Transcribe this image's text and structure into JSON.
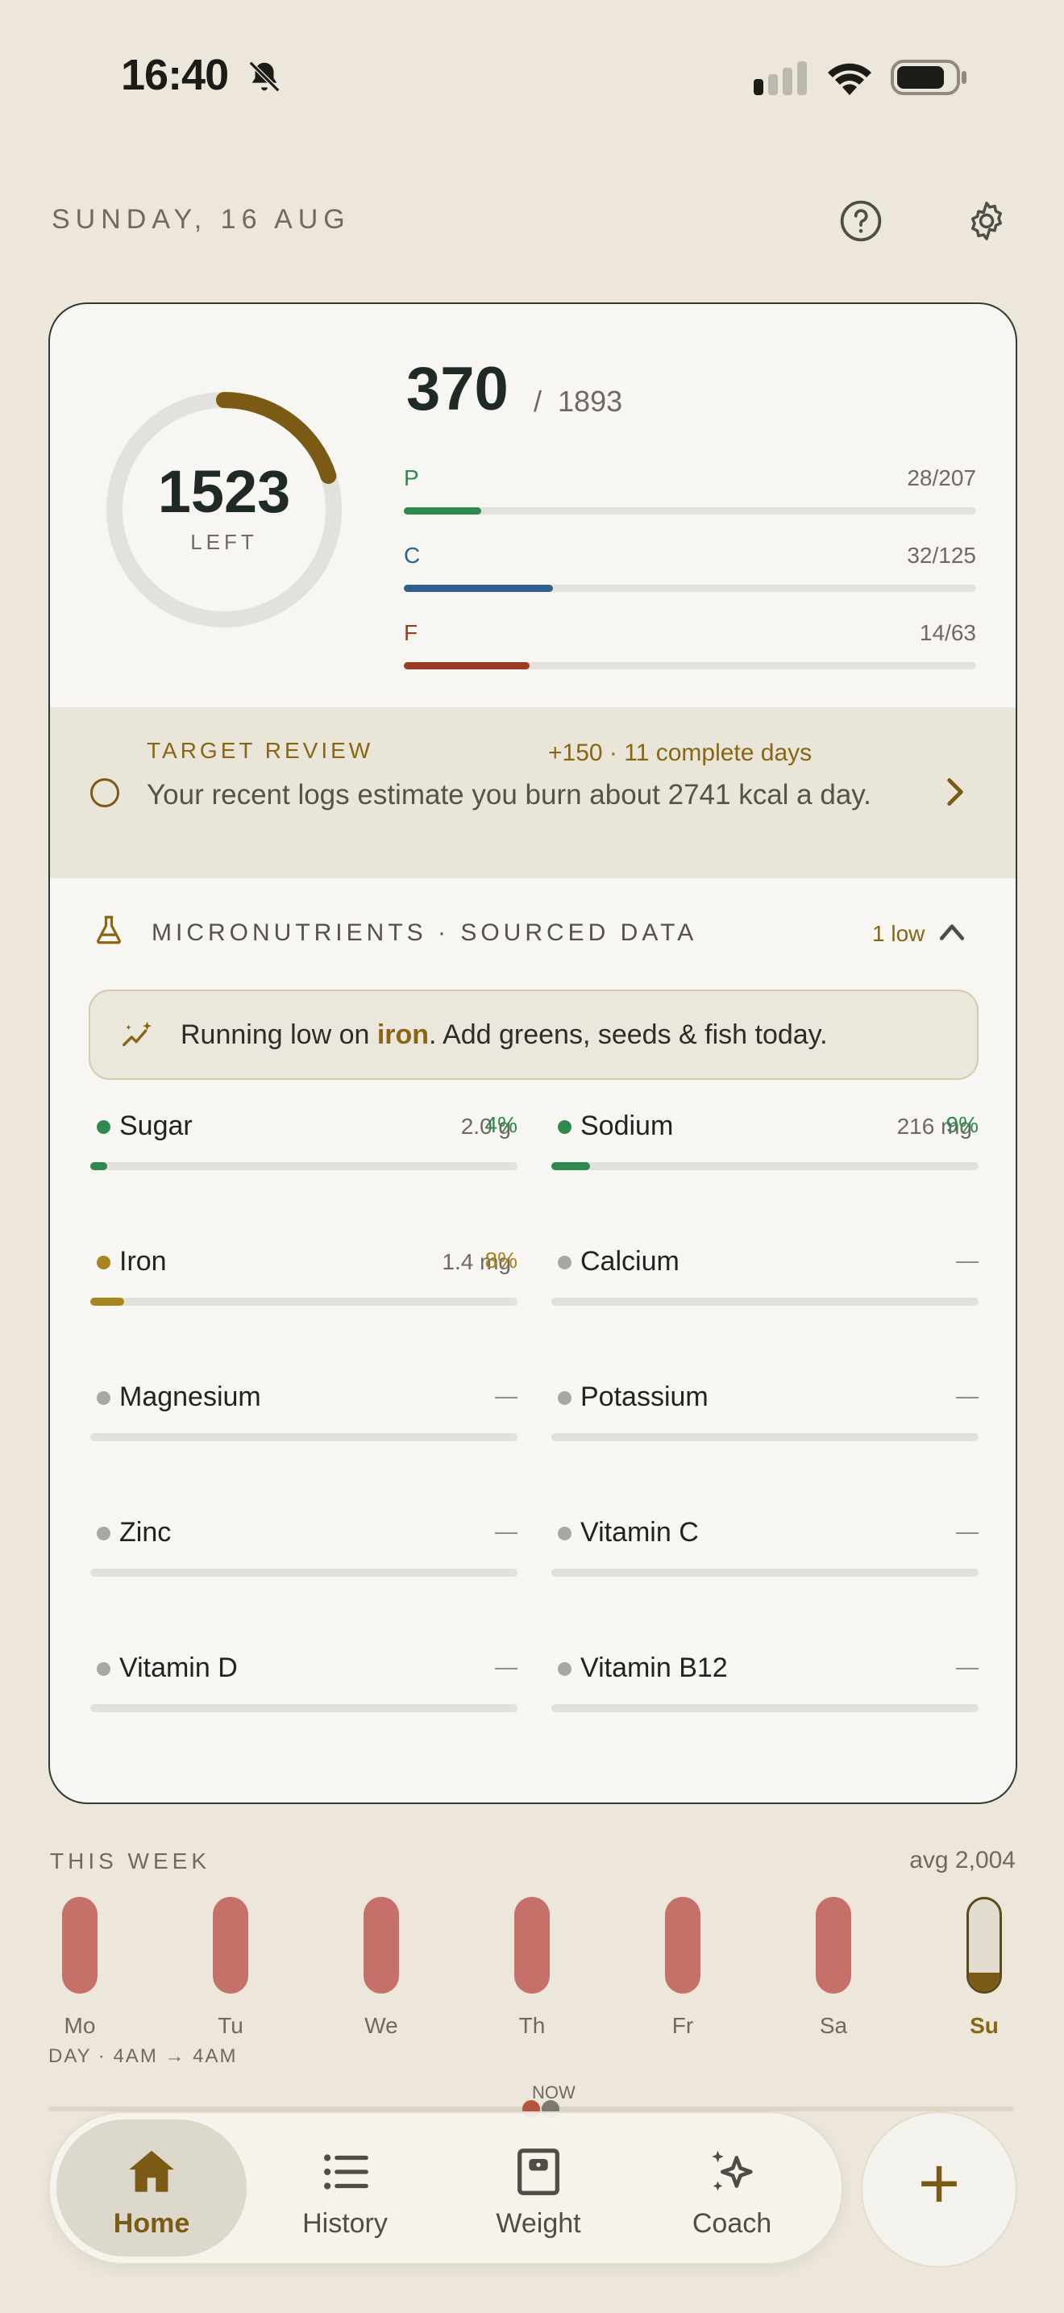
{
  "status": {
    "time": "16:40"
  },
  "header": {
    "date": "SUNDAY, 16 AUG"
  },
  "summary": {
    "left_value": "1523",
    "left_label": "LEFT",
    "eaten": "370",
    "separator": "/",
    "target": "1893",
    "ring_progress": 0.2,
    "macros": [
      {
        "letter": "P",
        "value": "28/207",
        "fraction": 0.135,
        "color": "#2e8a4c"
      },
      {
        "letter": "C",
        "value": "32/125",
        "fraction": 0.26,
        "color": "#2f5f8c"
      },
      {
        "letter": "F",
        "value": "14/63",
        "fraction": 0.22,
        "color": "#9b3b22"
      }
    ]
  },
  "review": {
    "title": "TARGET REVIEW",
    "badge": "+150 · 11 complete days",
    "text": "Your recent logs estimate you burn about 2741 kcal a day."
  },
  "micro": {
    "title": "MICRONUTRIENTS · SOURCED DATA",
    "low_count": "1 low",
    "hint_prefix": "Running low on ",
    "hint_bold": "iron",
    "hint_suffix": ". Add greens, seeds & fish today.",
    "dash": "—",
    "items": [
      {
        "name": "Sugar",
        "amount": "2.0 g",
        "pct": "4%",
        "fraction": 0.04,
        "color": "#2e8a4c"
      },
      {
        "name": "Sodium",
        "amount": "216 mg",
        "pct": "9%",
        "fraction": 0.09,
        "color": "#2e8a4c"
      },
      {
        "name": "Iron",
        "amount": "1.4 mg",
        "pct": "8%",
        "fraction": 0.08,
        "color": "#a8841e"
      },
      {
        "name": "Calcium",
        "amount": "",
        "pct": "",
        "fraction": 0,
        "color": "#a9a7a2"
      },
      {
        "name": "Magnesium",
        "amount": "",
        "pct": "",
        "fraction": 0,
        "color": "#a9a7a2"
      },
      {
        "name": "Potassium",
        "amount": "",
        "pct": "",
        "fraction": 0,
        "color": "#a9a7a2"
      },
      {
        "name": "Zinc",
        "amount": "",
        "pct": "",
        "fraction": 0,
        "color": "#a9a7a2"
      },
      {
        "name": "Vitamin C",
        "amount": "",
        "pct": "",
        "fraction": 0,
        "color": "#a9a7a2"
      },
      {
        "name": "Vitamin D",
        "amount": "",
        "pct": "",
        "fraction": 0,
        "color": "#a9a7a2"
      },
      {
        "name": "Vitamin B12",
        "amount": "",
        "pct": "",
        "fraction": 0,
        "color": "#a9a7a2"
      }
    ]
  },
  "week": {
    "title": "THIS WEEK",
    "avg": "avg 2,004",
    "days": [
      "Mo",
      "Tu",
      "We",
      "Th",
      "Fr",
      "Sa",
      "Su"
    ],
    "today_index": 6,
    "today_fill_fraction": 0.2,
    "range": "DAY · 4AM → 4AM",
    "now_label": "NOW"
  },
  "nav": {
    "items": [
      {
        "label": "Home",
        "icon": "home-icon"
      },
      {
        "label": "History",
        "icon": "list-icon"
      },
      {
        "label": "Weight",
        "icon": "scale-icon"
      },
      {
        "label": "Coach",
        "icon": "sparkle-icon"
      }
    ],
    "active": "Home",
    "add": "+"
  },
  "colors": {
    "accent": "#7a5a14",
    "bar_over": "#c5716a",
    "background": "#ece7da"
  }
}
